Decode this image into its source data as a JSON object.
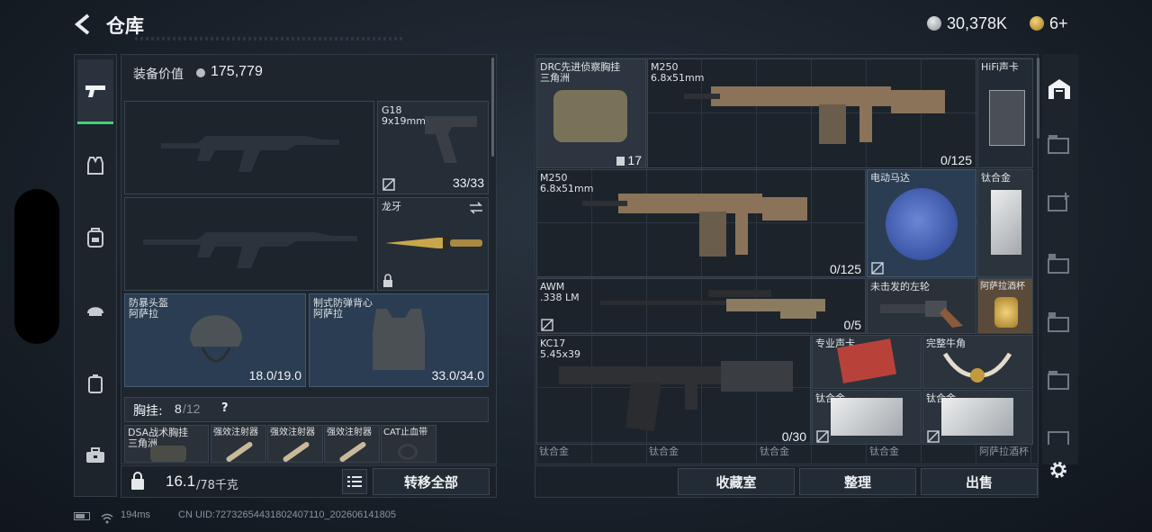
{
  "header": {
    "title": "仓库",
    "currency": "30,378K",
    "tickets": "6+"
  },
  "status_bar": {
    "ping": "194ms",
    "uid": "CN UID:7273265443180240711​0_202606141805"
  },
  "left_panel": {
    "equip_value_label": "装备价值",
    "equip_value": "175,779",
    "pistol": {
      "name": "G18",
      "caliber": "9x19mm",
      "ammo": "33/33"
    },
    "melee": {
      "name": "龙牙"
    },
    "helmet": {
      "name": "防暴头盔",
      "origin": "阿萨拉",
      "durability": "18.0/19.0"
    },
    "armor": {
      "name": "制式防弹背心",
      "origin": "阿萨拉",
      "durability": "33.0/34.0"
    },
    "rig_label": "胸挂:",
    "rig_count": "8",
    "rig_total": "/12",
    "rig_help": "?",
    "rig_items": [
      {
        "name": "DSA战术胸挂",
        "sub": "三角洲"
      },
      {
        "name": "强效注射器"
      },
      {
        "name": "强效注射器"
      },
      {
        "name": "强效注射器"
      },
      {
        "name": "CAT止血带"
      }
    ],
    "weight": "16.1",
    "weight_max": "/78千克",
    "transfer_all": "转移全部"
  },
  "storage": {
    "items": [
      {
        "name": "DRC先进侦察胸挂",
        "sub": "三角洲",
        "count": "17"
      },
      {
        "name": "M250",
        "sub": "6.8x51mm",
        "count": "0/125"
      },
      {
        "name": "HiFi声卡"
      },
      {
        "name": "M250",
        "sub": "6.8x51mm",
        "count": "0/125"
      },
      {
        "name": "电动马达"
      },
      {
        "name": "钛合金"
      },
      {
        "name": "AWM",
        "sub": ".338 LM",
        "count": "0/5"
      },
      {
        "name": "未击发的左轮"
      },
      {
        "name": "阿萨拉酒杯"
      },
      {
        "name": "KC17",
        "sub": "5.45x39",
        "count": "0/30"
      },
      {
        "name": "专业声卡"
      },
      {
        "name": "完整牛角"
      },
      {
        "name": "钛合金"
      },
      {
        "name": "钛合金"
      }
    ],
    "bottom_row": [
      "钛合金",
      "钛合金",
      "钛合金",
      "钛合金",
      "阿萨拉酒杯"
    ],
    "buttons": {
      "collection": "收藏室",
      "sort": "整理",
      "sell": "出售"
    }
  },
  "colors": {
    "accent_green": "#3fd17a",
    "gold": "#c8a04a"
  }
}
